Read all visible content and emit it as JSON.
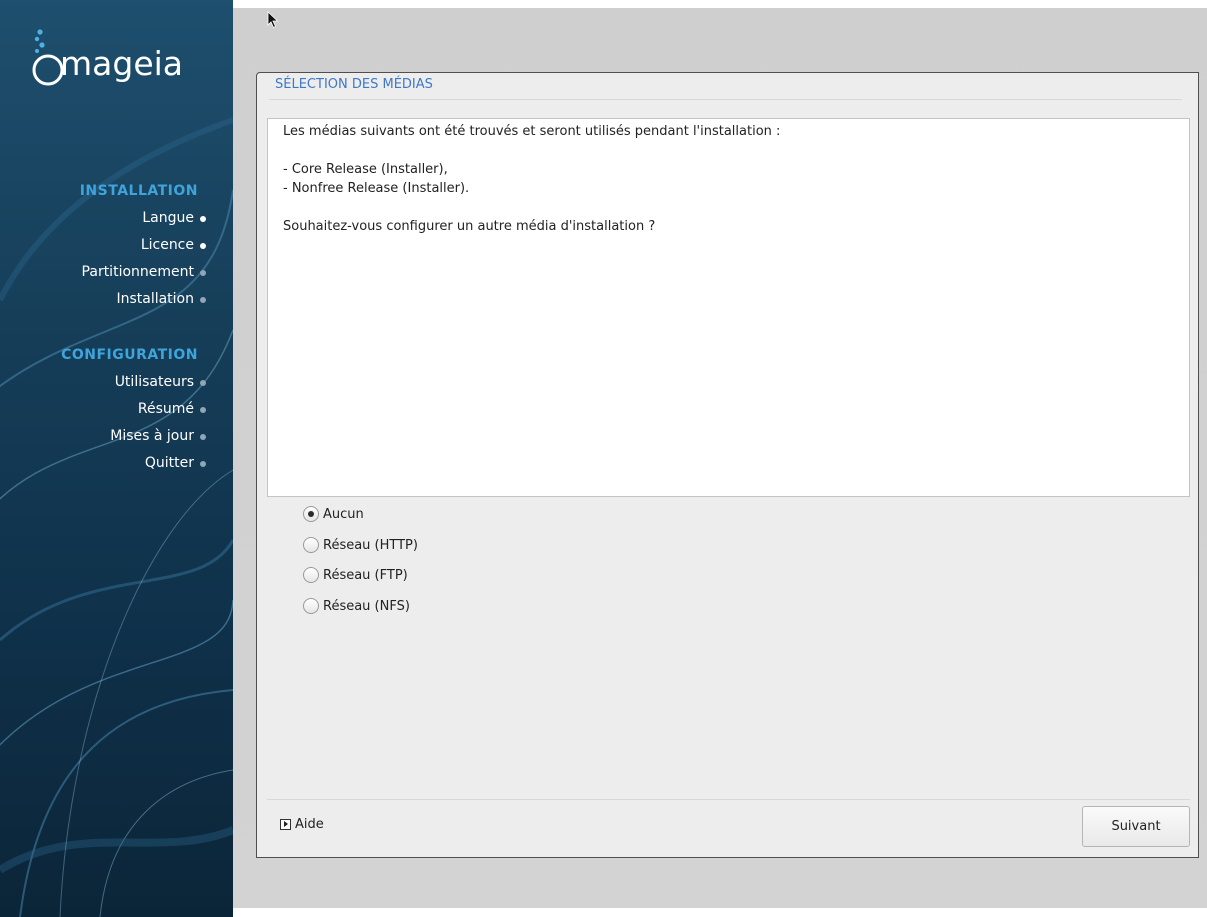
{
  "sidebar": {
    "brand": "mageia",
    "sections": [
      {
        "title": "INSTALLATION",
        "steps": [
          {
            "label": "Langue",
            "state": "done"
          },
          {
            "label": "Licence",
            "state": "done"
          },
          {
            "label": "Partitionnement",
            "state": "future"
          },
          {
            "label": "Installation",
            "state": "future"
          }
        ]
      },
      {
        "title": "CONFIGURATION",
        "steps": [
          {
            "label": "Utilisateurs",
            "state": "future"
          },
          {
            "label": "Résumé",
            "state": "future"
          },
          {
            "label": "Mises à jour",
            "state": "future"
          },
          {
            "label": "Quitter",
            "state": "future"
          }
        ]
      }
    ]
  },
  "panel": {
    "title": "SÉLECTION DES MÉDIAS",
    "message": {
      "intro": "Les médias suivants ont été trouvés et seront utilisés pendant l'installation :",
      "media": [
        "- Core Release (Installer),",
        "- Nonfree Release (Installer)."
      ],
      "question": "Souhaitez-vous configurer un autre média d'installation ?"
    },
    "options": [
      {
        "label": "Aucun",
        "checked": true
      },
      {
        "label": "Réseau (HTTP)",
        "checked": false
      },
      {
        "label": "Réseau (FTP)",
        "checked": false
      },
      {
        "label": "Réseau (NFS)",
        "checked": false
      }
    ],
    "help_label": "Aide",
    "next_label": "Suivant"
  },
  "colors": {
    "accent": "#3e78c7",
    "sidebar_heading": "#3ea4db",
    "sidebar_bg": "#163e59"
  }
}
